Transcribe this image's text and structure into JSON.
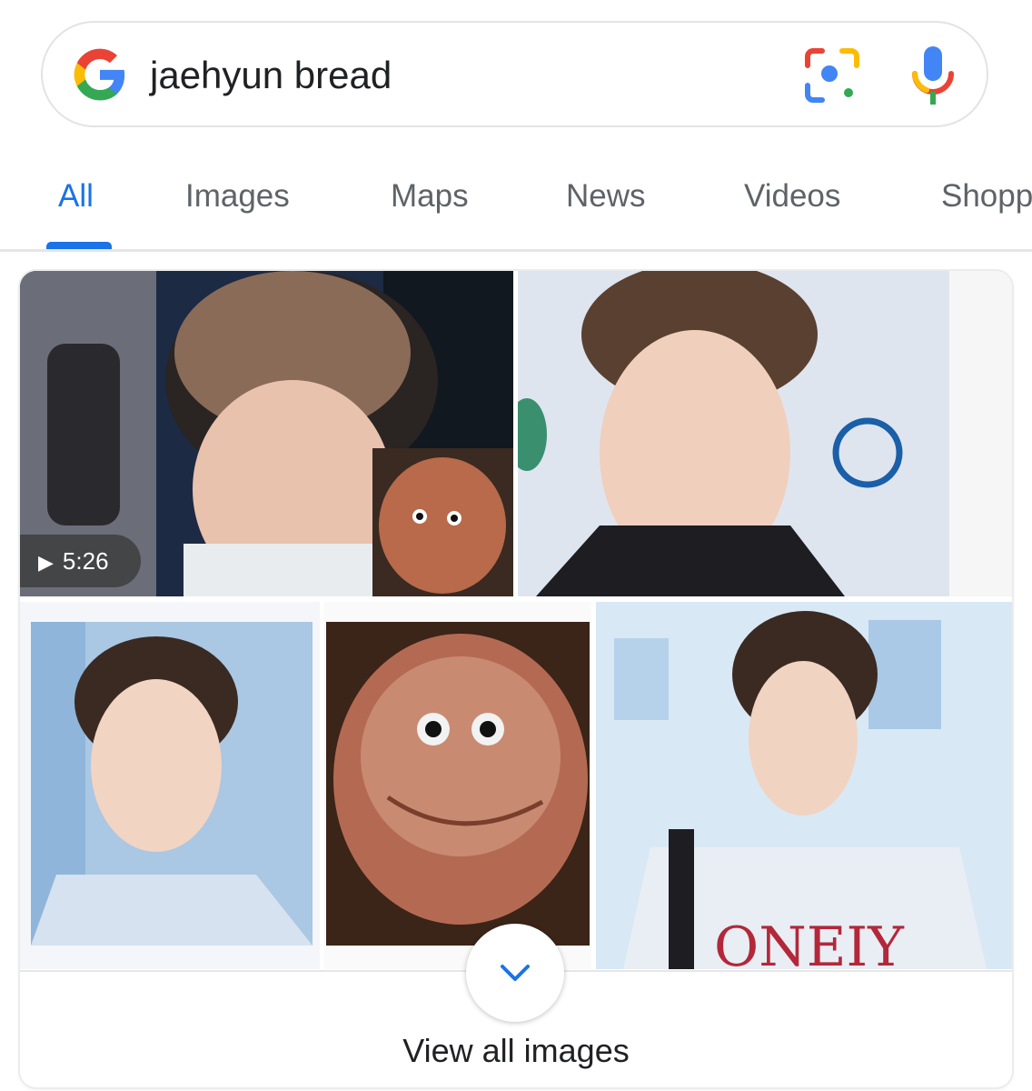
{
  "search": {
    "query": "jaehyun bread"
  },
  "tabs": [
    {
      "label": "All",
      "active": true
    },
    {
      "label": "Images",
      "active": false
    },
    {
      "label": "Maps",
      "active": false
    },
    {
      "label": "News",
      "active": false
    },
    {
      "label": "Videos",
      "active": false
    },
    {
      "label": "Shopp",
      "active": false
    }
  ],
  "images": {
    "video_duration": "5:26",
    "view_all_label": "View all images"
  },
  "colors": {
    "accent": "#1a73e8",
    "google_blue": "#4285f4",
    "google_red": "#ea4335",
    "google_yellow": "#fbbc05",
    "google_green": "#34a853"
  }
}
